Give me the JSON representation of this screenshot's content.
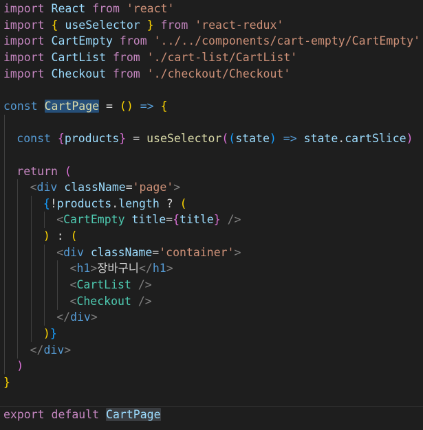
{
  "editor": {
    "file_language": "javascript-react",
    "lines": [
      {
        "indent": 0,
        "guides": [],
        "tokens": [
          {
            "t": "import",
            "c": "kw"
          },
          {
            "t": " ",
            "c": "pl"
          },
          {
            "t": "React",
            "c": "var"
          },
          {
            "t": " ",
            "c": "pl"
          },
          {
            "t": "from",
            "c": "kw"
          },
          {
            "t": " ",
            "c": "pl"
          },
          {
            "t": "'react'",
            "c": "str"
          }
        ]
      },
      {
        "indent": 0,
        "guides": [],
        "tokens": [
          {
            "t": "import",
            "c": "kw"
          },
          {
            "t": " ",
            "c": "pl"
          },
          {
            "t": "{",
            "c": "b1"
          },
          {
            "t": " ",
            "c": "pl"
          },
          {
            "t": "useSelector",
            "c": "var"
          },
          {
            "t": " ",
            "c": "pl"
          },
          {
            "t": "}",
            "c": "b1"
          },
          {
            "t": " ",
            "c": "pl"
          },
          {
            "t": "from",
            "c": "kw"
          },
          {
            "t": " ",
            "c": "pl"
          },
          {
            "t": "'react-redux'",
            "c": "str"
          }
        ]
      },
      {
        "indent": 0,
        "guides": [],
        "tokens": [
          {
            "t": "import",
            "c": "kw"
          },
          {
            "t": " ",
            "c": "pl"
          },
          {
            "t": "CartEmpty",
            "c": "var"
          },
          {
            "t": " ",
            "c": "pl"
          },
          {
            "t": "from",
            "c": "kw"
          },
          {
            "t": " ",
            "c": "pl"
          },
          {
            "t": "'../../components/cart-empty/CartEmpty'",
            "c": "str"
          }
        ]
      },
      {
        "indent": 0,
        "guides": [],
        "tokens": [
          {
            "t": "import",
            "c": "kw"
          },
          {
            "t": " ",
            "c": "pl"
          },
          {
            "t": "CartList",
            "c": "var"
          },
          {
            "t": " ",
            "c": "pl"
          },
          {
            "t": "from",
            "c": "kw"
          },
          {
            "t": " ",
            "c": "pl"
          },
          {
            "t": "'./cart-list/CartList'",
            "c": "str"
          }
        ]
      },
      {
        "indent": 0,
        "guides": [],
        "tokens": [
          {
            "t": "import",
            "c": "kw"
          },
          {
            "t": " ",
            "c": "pl"
          },
          {
            "t": "Checkout",
            "c": "var"
          },
          {
            "t": " ",
            "c": "pl"
          },
          {
            "t": "from",
            "c": "kw"
          },
          {
            "t": " ",
            "c": "pl"
          },
          {
            "t": "'./checkout/Checkout'",
            "c": "str"
          }
        ]
      },
      {
        "indent": 0,
        "guides": [],
        "tokens": []
      },
      {
        "indent": 0,
        "guides": [],
        "tokens": [
          {
            "t": "const",
            "c": "kw2"
          },
          {
            "t": " ",
            "c": "pl"
          },
          {
            "t": "CartPage",
            "c": "fn",
            "hl": true
          },
          {
            "t": " ",
            "c": "pl"
          },
          {
            "t": "=",
            "c": "pl"
          },
          {
            "t": " ",
            "c": "pl"
          },
          {
            "t": "()",
            "c": "b1"
          },
          {
            "t": " ",
            "c": "pl"
          },
          {
            "t": "=>",
            "c": "kw2"
          },
          {
            "t": " ",
            "c": "pl"
          },
          {
            "t": "{",
            "c": "b1"
          }
        ]
      },
      {
        "indent": 0,
        "guides": [
          1
        ],
        "tokens": []
      },
      {
        "indent": 1,
        "guides": [
          1
        ],
        "tokens": [
          {
            "t": "const",
            "c": "kw2"
          },
          {
            "t": " ",
            "c": "pl"
          },
          {
            "t": "{",
            "c": "b2"
          },
          {
            "t": "products",
            "c": "var"
          },
          {
            "t": "}",
            "c": "b2"
          },
          {
            "t": " ",
            "c": "pl"
          },
          {
            "t": "=",
            "c": "pl"
          },
          {
            "t": " ",
            "c": "pl"
          },
          {
            "t": "useSelector",
            "c": "fn"
          },
          {
            "t": "(",
            "c": "b2"
          },
          {
            "t": "(",
            "c": "b3"
          },
          {
            "t": "state",
            "c": "var"
          },
          {
            "t": ")",
            "c": "b3"
          },
          {
            "t": " ",
            "c": "pl"
          },
          {
            "t": "=>",
            "c": "kw2"
          },
          {
            "t": " ",
            "c": "pl"
          },
          {
            "t": "state",
            "c": "var"
          },
          {
            "t": ".",
            "c": "pl"
          },
          {
            "t": "cartSlice",
            "c": "var"
          },
          {
            "t": ")",
            "c": "b2"
          }
        ]
      },
      {
        "indent": 0,
        "guides": [
          1
        ],
        "tokens": []
      },
      {
        "indent": 1,
        "guides": [
          1
        ],
        "tokens": [
          {
            "t": "return",
            "c": "kw"
          },
          {
            "t": " ",
            "c": "pl"
          },
          {
            "t": "(",
            "c": "b2"
          }
        ]
      },
      {
        "indent": 2,
        "guides": [
          1,
          2
        ],
        "tokens": [
          {
            "t": "<",
            "c": "gray"
          },
          {
            "t": "div",
            "c": "tag"
          },
          {
            "t": " ",
            "c": "pl"
          },
          {
            "t": "className",
            "c": "var"
          },
          {
            "t": "=",
            "c": "pl"
          },
          {
            "t": "'page'",
            "c": "str"
          },
          {
            "t": ">",
            "c": "gray"
          }
        ]
      },
      {
        "indent": 3,
        "guides": [
          1,
          2,
          3
        ],
        "tokens": [
          {
            "t": "{",
            "c": "b3"
          },
          {
            "t": "!",
            "c": "pl"
          },
          {
            "t": "products",
            "c": "var"
          },
          {
            "t": ".",
            "c": "pl"
          },
          {
            "t": "length",
            "c": "var"
          },
          {
            "t": " ",
            "c": "pl"
          },
          {
            "t": "?",
            "c": "pl"
          },
          {
            "t": " ",
            "c": "pl"
          },
          {
            "t": "(",
            "c": "b1"
          }
        ]
      },
      {
        "indent": 4,
        "guides": [
          1,
          2,
          3,
          4
        ],
        "tokens": [
          {
            "t": "<",
            "c": "gray"
          },
          {
            "t": "CartEmpty",
            "c": "cmp"
          },
          {
            "t": " ",
            "c": "pl"
          },
          {
            "t": "title",
            "c": "var"
          },
          {
            "t": "=",
            "c": "pl"
          },
          {
            "t": "{",
            "c": "b2"
          },
          {
            "t": "title",
            "c": "var"
          },
          {
            "t": "}",
            "c": "b2"
          },
          {
            "t": " ",
            "c": "pl"
          },
          {
            "t": "/>",
            "c": "gray"
          }
        ]
      },
      {
        "indent": 3,
        "guides": [
          1,
          2,
          3
        ],
        "tokens": [
          {
            "t": ")",
            "c": "b1"
          },
          {
            "t": " ",
            "c": "pl"
          },
          {
            "t": ":",
            "c": "pl"
          },
          {
            "t": " ",
            "c": "pl"
          },
          {
            "t": "(",
            "c": "b1"
          }
        ]
      },
      {
        "indent": 4,
        "guides": [
          1,
          2,
          3,
          4
        ],
        "tokens": [
          {
            "t": "<",
            "c": "gray"
          },
          {
            "t": "div",
            "c": "tag"
          },
          {
            "t": " ",
            "c": "pl"
          },
          {
            "t": "className",
            "c": "var"
          },
          {
            "t": "=",
            "c": "pl"
          },
          {
            "t": "'container'",
            "c": "str"
          },
          {
            "t": ">",
            "c": "gray"
          }
        ]
      },
      {
        "indent": 5,
        "guides": [
          1,
          2,
          3,
          4,
          5
        ],
        "tokens": [
          {
            "t": "<",
            "c": "gray"
          },
          {
            "t": "h1",
            "c": "tag"
          },
          {
            "t": ">",
            "c": "gray"
          },
          {
            "t": "장바구니",
            "c": "pl"
          },
          {
            "t": "</",
            "c": "gray"
          },
          {
            "t": "h1",
            "c": "tag"
          },
          {
            "t": ">",
            "c": "gray"
          }
        ]
      },
      {
        "indent": 5,
        "guides": [
          1,
          2,
          3,
          4,
          5
        ],
        "tokens": [
          {
            "t": "<",
            "c": "gray"
          },
          {
            "t": "CartList",
            "c": "cmp"
          },
          {
            "t": " ",
            "c": "pl"
          },
          {
            "t": "/>",
            "c": "gray"
          }
        ]
      },
      {
        "indent": 5,
        "guides": [
          1,
          2,
          3,
          4,
          5
        ],
        "tokens": [
          {
            "t": "<",
            "c": "gray"
          },
          {
            "t": "Checkout",
            "c": "cmp"
          },
          {
            "t": " ",
            "c": "pl"
          },
          {
            "t": "/>",
            "c": "gray"
          }
        ]
      },
      {
        "indent": 4,
        "guides": [
          1,
          2,
          3,
          4
        ],
        "tokens": [
          {
            "t": "</",
            "c": "gray"
          },
          {
            "t": "div",
            "c": "tag"
          },
          {
            "t": ">",
            "c": "gray"
          }
        ]
      },
      {
        "indent": 3,
        "guides": [
          1,
          2,
          3
        ],
        "tokens": [
          {
            "t": ")",
            "c": "b1"
          },
          {
            "t": "}",
            "c": "b3"
          }
        ]
      },
      {
        "indent": 2,
        "guides": [
          1,
          2
        ],
        "tokens": [
          {
            "t": "</",
            "c": "gray"
          },
          {
            "t": "div",
            "c": "tag"
          },
          {
            "t": ">",
            "c": "gray"
          }
        ]
      },
      {
        "indent": 1,
        "guides": [
          1
        ],
        "tokens": [
          {
            "t": ")",
            "c": "b2"
          }
        ]
      },
      {
        "indent": 0,
        "guides": [],
        "tokens": [
          {
            "t": "}",
            "c": "b1"
          }
        ]
      },
      {
        "indent": 0,
        "guides": [],
        "tokens": []
      },
      {
        "indent": 0,
        "guides": [],
        "current": true,
        "tokens": [
          {
            "t": "export",
            "c": "kw"
          },
          {
            "t": " ",
            "c": "pl"
          },
          {
            "t": "default",
            "c": "kw"
          },
          {
            "t": " ",
            "c": "pl"
          },
          {
            "t": "CartPage",
            "c": "var",
            "hlgray": true
          }
        ]
      }
    ]
  },
  "theme": {
    "background": "#1e1e1e",
    "selection_highlight": "#264f78",
    "word_highlight": "#3a3d41",
    "indent_guide": "#404040"
  }
}
